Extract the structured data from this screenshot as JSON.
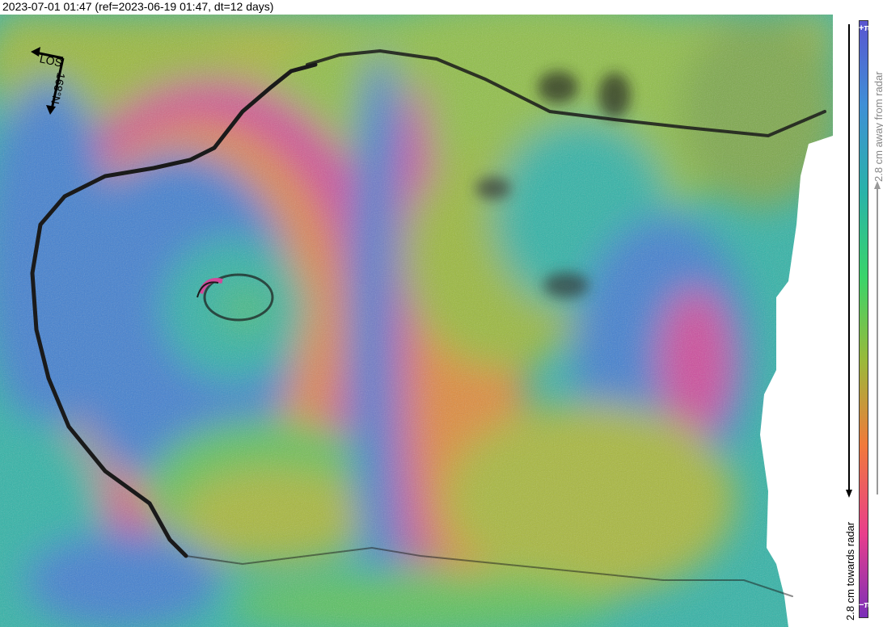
{
  "title": "2023-07-01 01:47 (ref=2023-06-19 01:47, dt=12 days)",
  "compass": {
    "los_label": "LOS",
    "heading_label": "168°N",
    "arrow_color": "#000000"
  },
  "colorbar": {
    "top_tick": "+π",
    "bottom_tick": "−π",
    "away_label": "2.8 cm away from radar",
    "towards_label": "2.8 cm towards radar",
    "cyclic_colors": [
      "#7b2fb8",
      "#e83e8c",
      "#f07a3a",
      "#9ab93a",
      "#3ad46a",
      "#29b3a8",
      "#3f8fd6",
      "#5a55d0"
    ]
  },
  "colors": {
    "phase_blue": "#3f7fd0",
    "phase_magenta": "#d04a9a",
    "phase_orange": "#e08a3a",
    "phase_green": "#5cc25a",
    "phase_teal": "#2fb3a6",
    "phase_yellowgreen": "#a8b83a",
    "coast_line": "#1a1a1a"
  }
}
